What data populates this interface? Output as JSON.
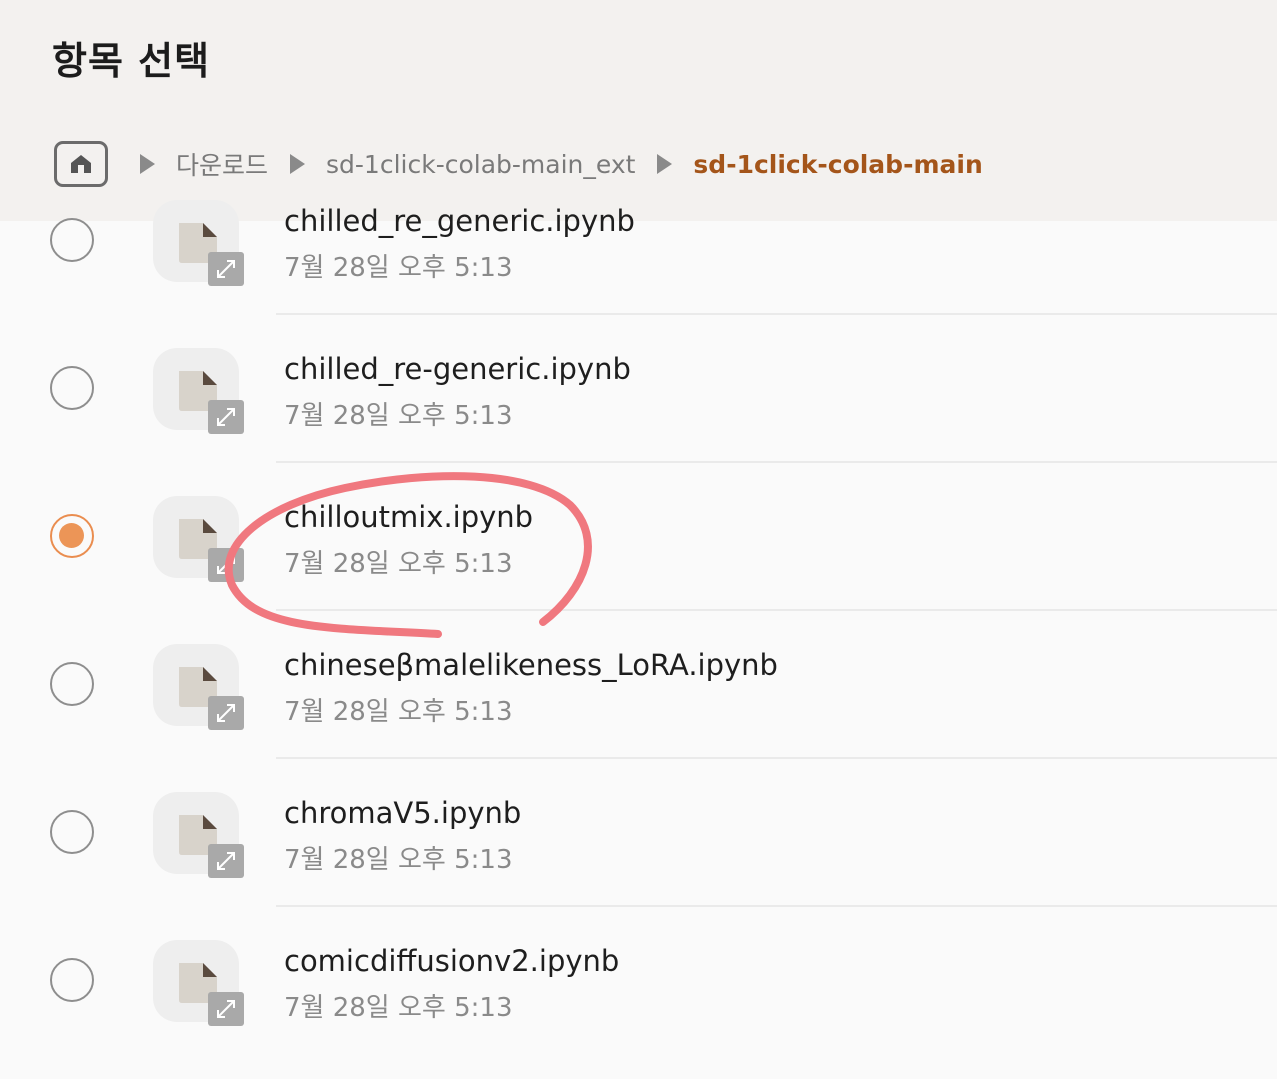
{
  "header": {
    "title": "항목 선택",
    "home_icon": "home-icon",
    "breadcrumbs": [
      {
        "label": "다운로드",
        "current": false
      },
      {
        "label": "sd-1click-colab-main_ext",
        "current": false
      },
      {
        "label": "sd-1click-colab-main",
        "current": true
      }
    ]
  },
  "files": [
    {
      "name": "chilled_re_generic.ipynb",
      "date": "7월 28일 오후 5:13",
      "selected": false
    },
    {
      "name": "chilled_re-generic.ipynb",
      "date": "7월 28일 오후 5:13",
      "selected": false
    },
    {
      "name": "chilloutmix.ipynb",
      "date": "7월 28일 오후 5:13",
      "selected": true
    },
    {
      "name": "chineseβmalelikeness_LoRA.ipynb",
      "date": "7월 28일 오후 5:13",
      "selected": false
    },
    {
      "name": "chromaV5.ipynb",
      "date": "7월 28일 오후 5:13",
      "selected": false
    },
    {
      "name": "comicdiffusionv2.ipynb",
      "date": "7월 28일 오후 5:13",
      "selected": false
    }
  ],
  "colors": {
    "accent": "#ec9557",
    "current_crumb": "#a4551a",
    "annotation": "#f0787f"
  }
}
